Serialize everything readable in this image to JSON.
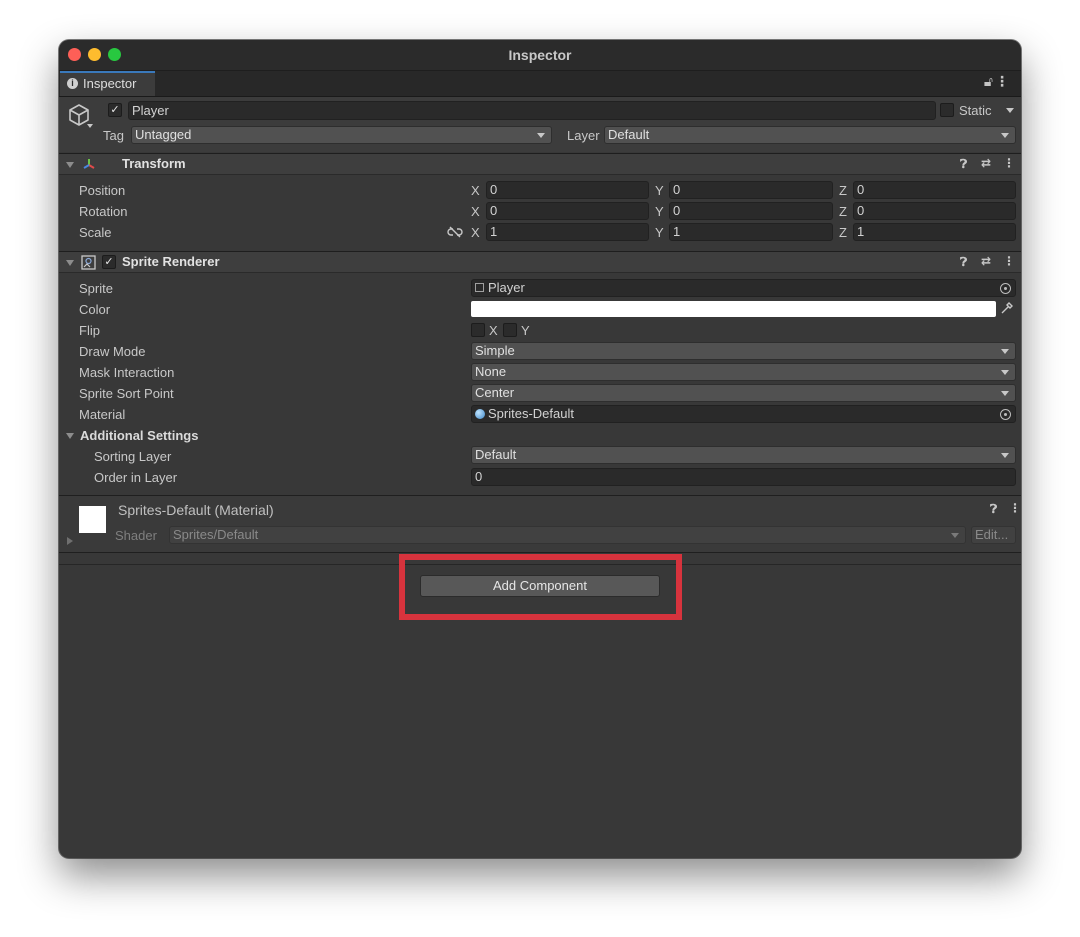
{
  "window": {
    "title": "Inspector"
  },
  "tab": {
    "label": "Inspector"
  },
  "gameobject": {
    "active": true,
    "name": "Player",
    "static_label": "Static",
    "tag_label": "Tag",
    "tag_value": "Untagged",
    "layer_label": "Layer",
    "layer_value": "Default"
  },
  "transform": {
    "title": "Transform",
    "rows": [
      {
        "label": "Position",
        "x": "0",
        "y": "0",
        "z": "0"
      },
      {
        "label": "Rotation",
        "x": "0",
        "y": "0",
        "z": "0"
      },
      {
        "label": "Scale",
        "x": "1",
        "y": "1",
        "z": "1"
      }
    ],
    "axis": {
      "x": "X",
      "y": "Y",
      "z": "Z"
    }
  },
  "sprite_renderer": {
    "title": "Sprite Renderer",
    "enabled": true,
    "sprite_label": "Sprite",
    "sprite_value": "Player",
    "color_label": "Color",
    "color_value": "#ffffff",
    "flip_label": "Flip",
    "flip_x": "X",
    "flip_y": "Y",
    "draw_mode_label": "Draw Mode",
    "draw_mode_value": "Simple",
    "mask_label": "Mask Interaction",
    "mask_value": "None",
    "sort_point_label": "Sprite Sort Point",
    "sort_point_value": "Center",
    "material_label": "Material",
    "material_value": "Sprites-Default",
    "additional_label": "Additional Settings",
    "sorting_layer_label": "Sorting Layer",
    "sorting_layer_value": "Default",
    "order_label": "Order in Layer",
    "order_value": "0"
  },
  "material": {
    "title": "Sprites-Default (Material)",
    "shader_label": "Shader",
    "shader_value": "Sprites/Default",
    "edit_label": "Edit..."
  },
  "add_component": {
    "label": "Add Component"
  },
  "colors": {
    "accent": "#3a79bb",
    "highlight": "#d7333d"
  }
}
